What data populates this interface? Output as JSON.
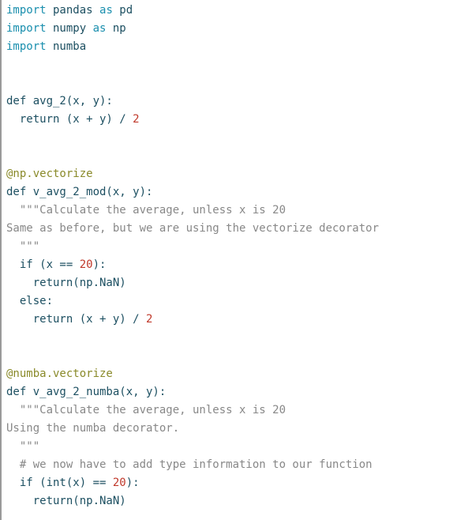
{
  "editor": {
    "language": "python",
    "background_color": "#ffffff",
    "left_border_color": "#9a9a9a",
    "colors": {
      "keyword_import": "#1a8fae",
      "plain_code": "#1c4f61",
      "decorator": "#8a8a2a",
      "number": "#c0392b",
      "docstring": "#888888",
      "comment": "#888888"
    },
    "lines": [
      {
        "id": "l1",
        "tokens": [
          {
            "text": "import",
            "type": "kw"
          },
          {
            "text": " pandas ",
            "type": "plain"
          },
          {
            "text": "as",
            "type": "kw"
          },
          {
            "text": " pd",
            "type": "plain"
          }
        ]
      },
      {
        "id": "l2",
        "tokens": [
          {
            "text": "import",
            "type": "kw"
          },
          {
            "text": " numpy ",
            "type": "plain"
          },
          {
            "text": "as",
            "type": "kw"
          },
          {
            "text": " np",
            "type": "plain"
          }
        ]
      },
      {
        "id": "l3",
        "tokens": [
          {
            "text": "import",
            "type": "kw"
          },
          {
            "text": " numba",
            "type": "plain"
          }
        ]
      },
      {
        "id": "l4",
        "tokens": []
      },
      {
        "id": "l5",
        "tokens": []
      },
      {
        "id": "l6",
        "tokens": [
          {
            "text": "def avg_2(x, y):",
            "type": "plain"
          }
        ]
      },
      {
        "id": "l7",
        "tokens": [
          {
            "text": "  return (x + y) / ",
            "type": "plain"
          },
          {
            "text": "2",
            "type": "num"
          }
        ]
      },
      {
        "id": "l8",
        "tokens": []
      },
      {
        "id": "l9",
        "tokens": []
      },
      {
        "id": "l10",
        "tokens": [
          {
            "text": "@np.vectorize",
            "type": "dec"
          }
        ]
      },
      {
        "id": "l11",
        "tokens": [
          {
            "text": "def v_avg_2_mod(x, y):",
            "type": "plain"
          }
        ]
      },
      {
        "id": "l12",
        "tokens": [
          {
            "text": "  \"\"\"Calculate the average, unless x is 20",
            "type": "doc"
          }
        ]
      },
      {
        "id": "l13",
        "tokens": [
          {
            "text": "Same as before, but we are using the vectorize decorator",
            "type": "doc"
          }
        ]
      },
      {
        "id": "l14",
        "tokens": [
          {
            "text": "  \"\"\"",
            "type": "doc"
          }
        ]
      },
      {
        "id": "l15",
        "tokens": [
          {
            "text": "  if (x == ",
            "type": "plain"
          },
          {
            "text": "20",
            "type": "num"
          },
          {
            "text": "):",
            "type": "plain"
          }
        ]
      },
      {
        "id": "l16",
        "tokens": [
          {
            "text": "    return(np.NaN)",
            "type": "plain"
          }
        ]
      },
      {
        "id": "l17",
        "tokens": [
          {
            "text": "  else:",
            "type": "plain"
          }
        ]
      },
      {
        "id": "l18",
        "tokens": [
          {
            "text": "    return (x + y) / ",
            "type": "plain"
          },
          {
            "text": "2",
            "type": "num"
          }
        ]
      },
      {
        "id": "l19",
        "tokens": []
      },
      {
        "id": "l20",
        "tokens": []
      },
      {
        "id": "l21",
        "tokens": [
          {
            "text": "@numba.vectorize",
            "type": "dec"
          }
        ]
      },
      {
        "id": "l22",
        "tokens": [
          {
            "text": "def v_avg_2_numba(x, y):",
            "type": "plain"
          }
        ]
      },
      {
        "id": "l23",
        "tokens": [
          {
            "text": "  \"\"\"Calculate the average, unless x is 20",
            "type": "doc"
          }
        ]
      },
      {
        "id": "l24",
        "tokens": [
          {
            "text": "Using the numba decorator.",
            "type": "doc"
          }
        ]
      },
      {
        "id": "l25",
        "tokens": [
          {
            "text": "  \"\"\"",
            "type": "doc"
          }
        ]
      },
      {
        "id": "l26",
        "tokens": [
          {
            "text": "  # we now have to add type information to our function",
            "type": "com"
          }
        ]
      },
      {
        "id": "l27",
        "tokens": [
          {
            "text": "  if (int(x) == ",
            "type": "plain"
          },
          {
            "text": "20",
            "type": "num"
          },
          {
            "text": "):",
            "type": "plain"
          }
        ]
      },
      {
        "id": "l28",
        "tokens": [
          {
            "text": "    return(np.NaN)",
            "type": "plain"
          }
        ]
      }
    ]
  }
}
